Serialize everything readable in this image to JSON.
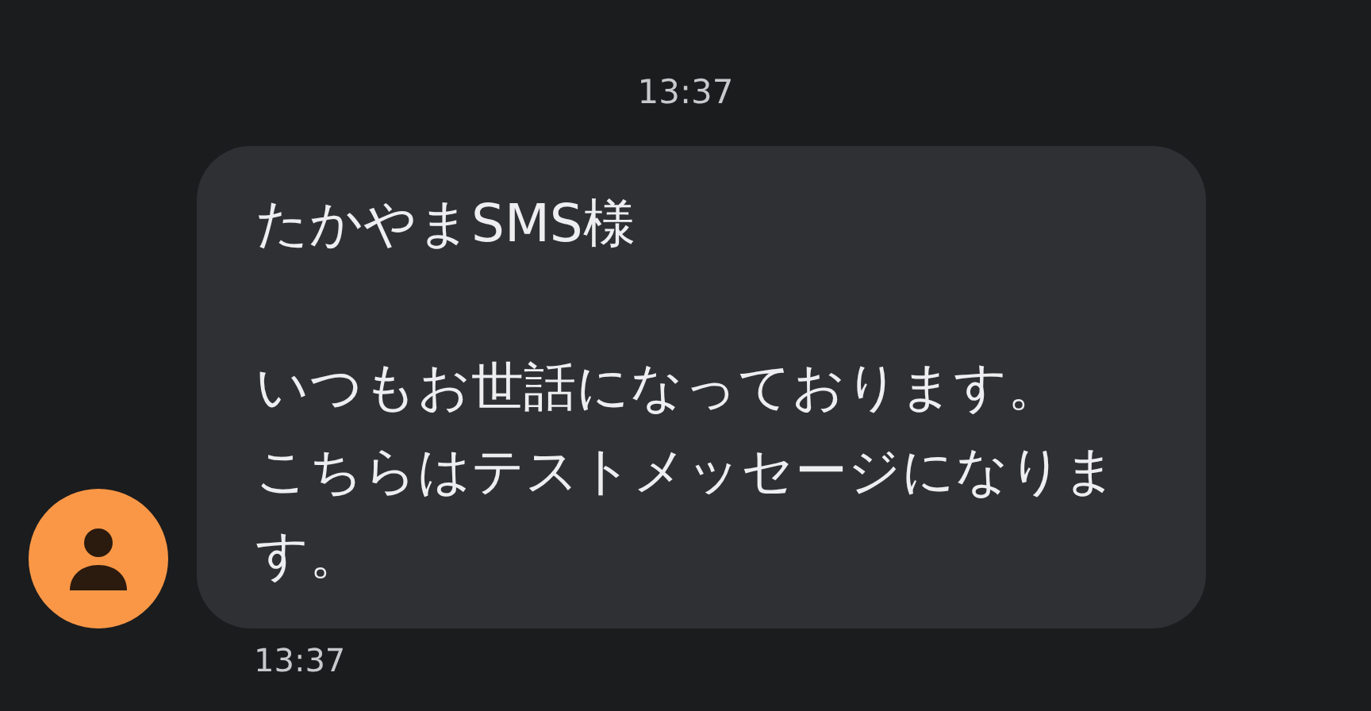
{
  "date_divider": "13:37",
  "message": {
    "paragraphs": [
      [
        "たかやまSMS様"
      ],
      [
        "いつもお世話になっております。",
        "こちらはテストメッセージになります。"
      ]
    ],
    "time": "13:37"
  }
}
